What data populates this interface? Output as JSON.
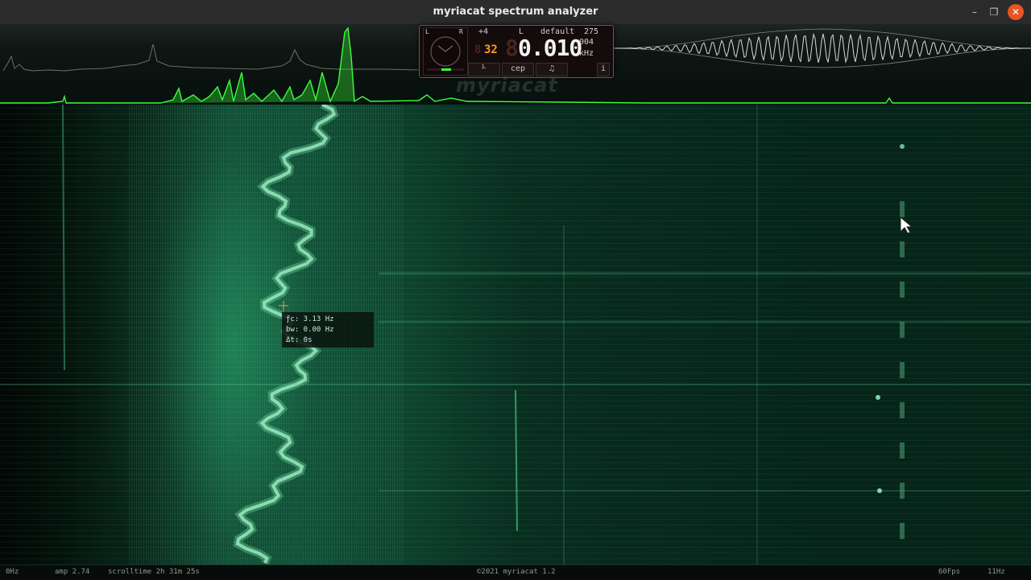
{
  "window": {
    "title": "myriacat spectrum analyzer",
    "minimize_glyph": "–",
    "maximize_glyph": "❐",
    "close_glyph": "✕"
  },
  "panel": {
    "gauge_left": "L",
    "gauge_right": "R",
    "offset": "+4",
    "channel": "L",
    "preset": "default",
    "preset_value": "275",
    "resolution": "32",
    "frequency": "0.010",
    "frequency_small": "004",
    "unit": "kHz",
    "buttons": [
      "cep",
      "i"
    ],
    "note_icon": "music-note-icon",
    "tuning_icon": "tuning-fork-icon"
  },
  "watermark": "myriacat",
  "tooltip": {
    "fc": "ƒc: 3.13 Hz",
    "bw": "bw: 0.00 Hz",
    "dt": "Δt: 0s"
  },
  "status": {
    "freq_min": "0Hz",
    "amp": "amp 2.74",
    "scrolltime": "scrolltime 2h 31m 25s",
    "copyright": "©2021 myriacat 1.2",
    "fps": "60Fps",
    "freq_max": "11Hz"
  },
  "colors": {
    "spectrum": "#3dff3d",
    "waterfall": "#2fb07c",
    "accent_orange": "#ff9a1a",
    "close_button": "#e95420"
  }
}
